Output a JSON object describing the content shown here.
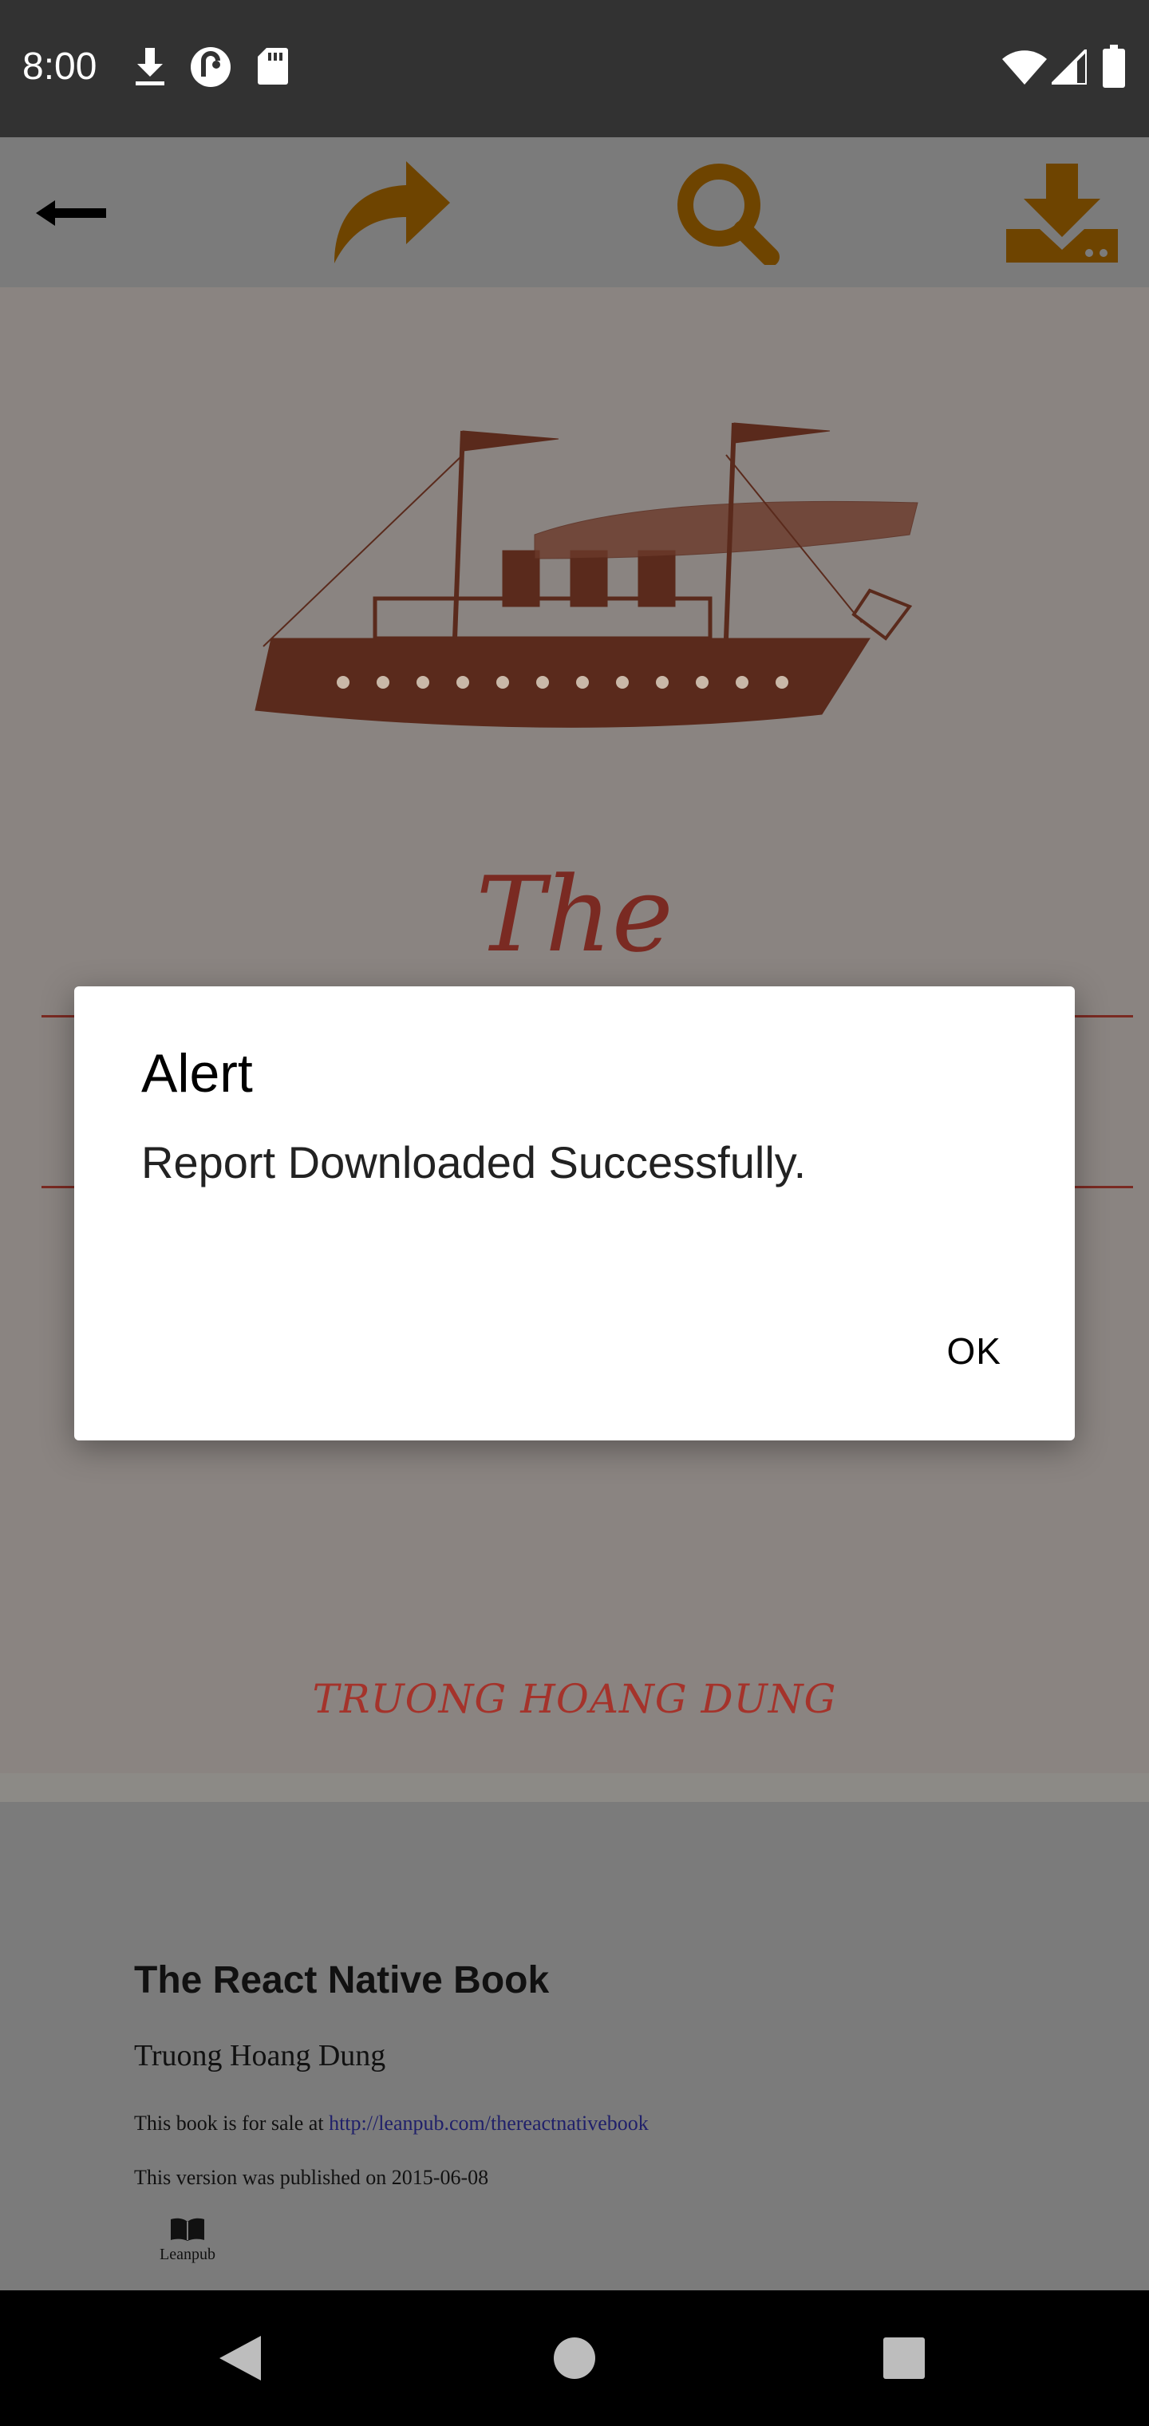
{
  "status_bar": {
    "time": "8:00",
    "icons": [
      "download-icon",
      "pocket-casts-icon",
      "sd-card-icon",
      "wifi-icon",
      "signal-icon",
      "battery-icon"
    ]
  },
  "toolbar": {
    "icons": [
      "back-arrow-icon",
      "share-icon",
      "search-icon",
      "download-icon"
    ],
    "accent_color": "#7a4b00"
  },
  "pdf_cover": {
    "title_fragment": "The",
    "author": "TRUONG HOANG DUNG",
    "cover_image": "steamship-illustration"
  },
  "pdf_page2": {
    "book_title": "The React Native Book",
    "author": "Truong Hoang Dung",
    "sale_text": "This book is for sale at",
    "sale_link": "http://leanpub.com/thereactnativebook",
    "version_text": "This version was published on 2015-06-08",
    "publisher": "Leanpub"
  },
  "dialog": {
    "title": "Alert",
    "message": "Report Downloaded Successfully.",
    "ok_label": "OK"
  },
  "nav_bar": {
    "icons": [
      "back-icon",
      "home-icon",
      "recents-icon"
    ]
  }
}
